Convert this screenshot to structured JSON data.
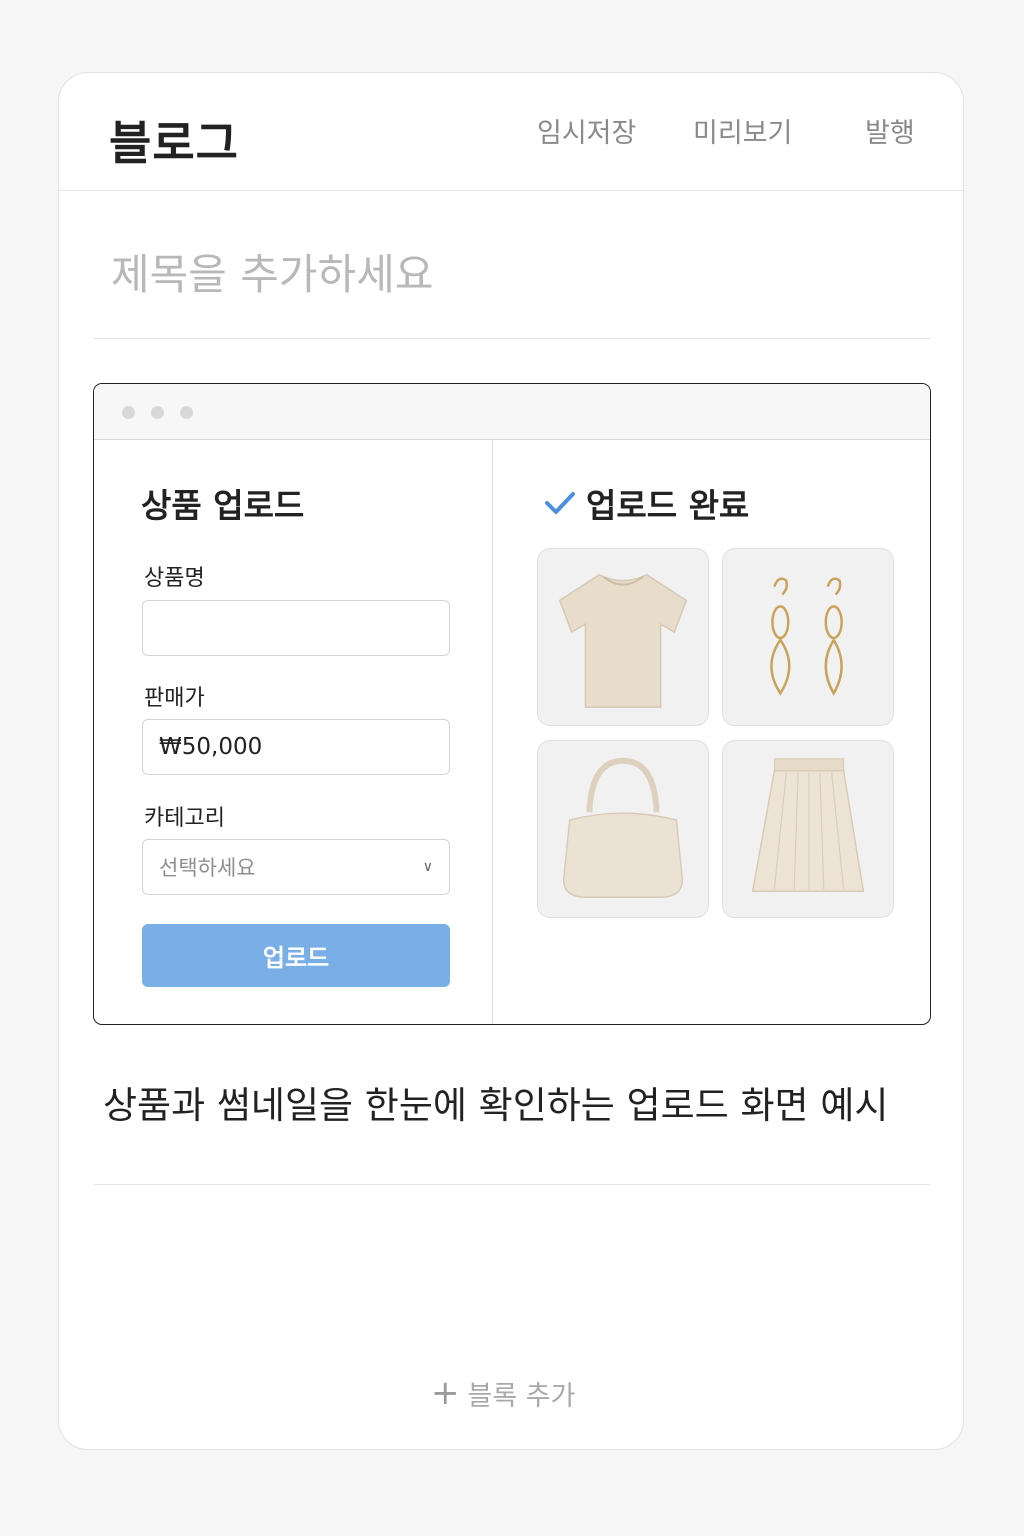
{
  "header": {
    "title": "블로그",
    "actions": {
      "draft": "임시저장",
      "preview": "미리보기",
      "publish": "발행"
    }
  },
  "post": {
    "title_placeholder": "제목을 추가하세요",
    "caption": "상품과 썸네일을 한눈에 확인하는 업로드 화면 예시"
  },
  "upload_form": {
    "heading": "상품 업로드",
    "name_label": "상품명",
    "name_value": "",
    "price_label": "판매가",
    "price_value": "₩50,000",
    "category_label": "카테고리",
    "category_value": "선택하세요",
    "submit_label": "업로드"
  },
  "upload_result": {
    "heading": "업로드 완료",
    "thumbnails": [
      {
        "icon": "tshirt-image"
      },
      {
        "icon": "earrings-image"
      },
      {
        "icon": "handbag-image"
      },
      {
        "icon": "skirt-image"
      }
    ]
  },
  "footer": {
    "add_block": "블록 추가"
  },
  "colors": {
    "accent_button": "#7aaee6",
    "check": "#4a90e2",
    "placeholder": "#b8b8b8",
    "product_beige": "#e8dccb"
  }
}
